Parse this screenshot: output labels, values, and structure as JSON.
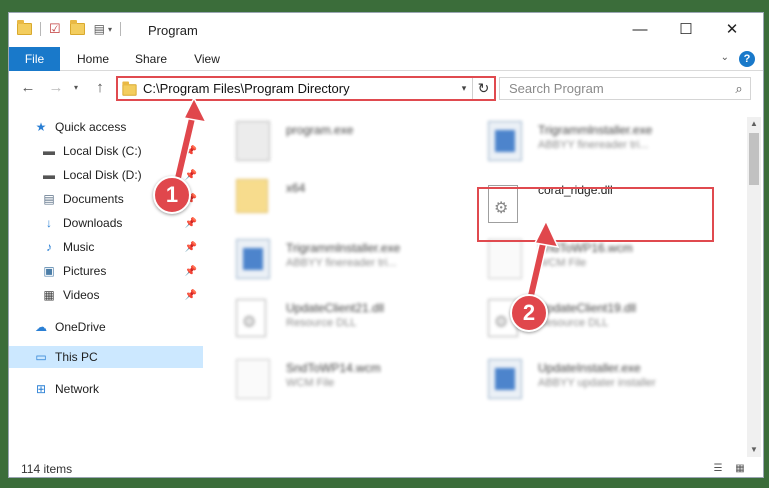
{
  "window": {
    "title": "Program",
    "controls": {
      "minimize": "—",
      "maximize": "☐",
      "close": "✕"
    }
  },
  "ribbon": {
    "tabs": [
      "File",
      "Home",
      "Share",
      "View"
    ],
    "help": "?"
  },
  "address_bar": {
    "path": "C:\\Program Files\\Program Directory"
  },
  "search": {
    "placeholder": "Search Program"
  },
  "sidebar": {
    "items": [
      {
        "label": "Quick access",
        "icon": "star-icon"
      },
      {
        "label": "Local Disk (C:)",
        "icon": "drive-icon",
        "pinned": true
      },
      {
        "label": "Local Disk (D:)",
        "icon": "drive-icon",
        "pinned": true
      },
      {
        "label": "Documents",
        "icon": "documents-icon",
        "pinned": true
      },
      {
        "label": "Downloads",
        "icon": "download-icon",
        "pinned": true
      },
      {
        "label": "Music",
        "icon": "music-icon",
        "pinned": true
      },
      {
        "label": "Pictures",
        "icon": "pictures-icon",
        "pinned": true
      },
      {
        "label": "Videos",
        "icon": "videos-icon",
        "pinned": true
      },
      {
        "label": "OneDrive",
        "icon": "cloud-icon"
      },
      {
        "label": "This PC",
        "icon": "computer-icon",
        "selected": true
      },
      {
        "label": "Network",
        "icon": "network-icon"
      }
    ]
  },
  "files": [
    {
      "name": "program.exe",
      "sub": "",
      "type": "app-exe"
    },
    {
      "name": "Trigrammlnstaller.exe",
      "sub": "ABBYY finereader tri...",
      "type": "app"
    },
    {
      "name": "x64",
      "sub": "",
      "type": "folder"
    },
    {
      "name": "coral_ridge.dll",
      "sub": "",
      "type": "dll"
    },
    {
      "name": "Trigrammlnstaller.exe",
      "sub": "ABBYY finereader tri...",
      "type": "app"
    },
    {
      "name": "SndToWP16.wcm",
      "sub": "WCM File",
      "type": "doc"
    },
    {
      "name": "UpdateClient21.dll",
      "sub": "Resource DLL",
      "type": "dll"
    },
    {
      "name": "UpdateClient19.dll",
      "sub": "Resource DLL",
      "type": "dll"
    },
    {
      "name": "SndToWP14.wcm",
      "sub": "WCM File",
      "type": "doc"
    },
    {
      "name": "UpdateInstaller.exe",
      "sub": "ABBYY updater installer",
      "type": "app"
    }
  ],
  "status": {
    "items_count": "114 items"
  },
  "callouts": {
    "one": "1",
    "two": "2"
  },
  "colors": {
    "accent": "#1979ca",
    "highlight": "#e04a4f",
    "selected_nav": "#cce8ff"
  }
}
